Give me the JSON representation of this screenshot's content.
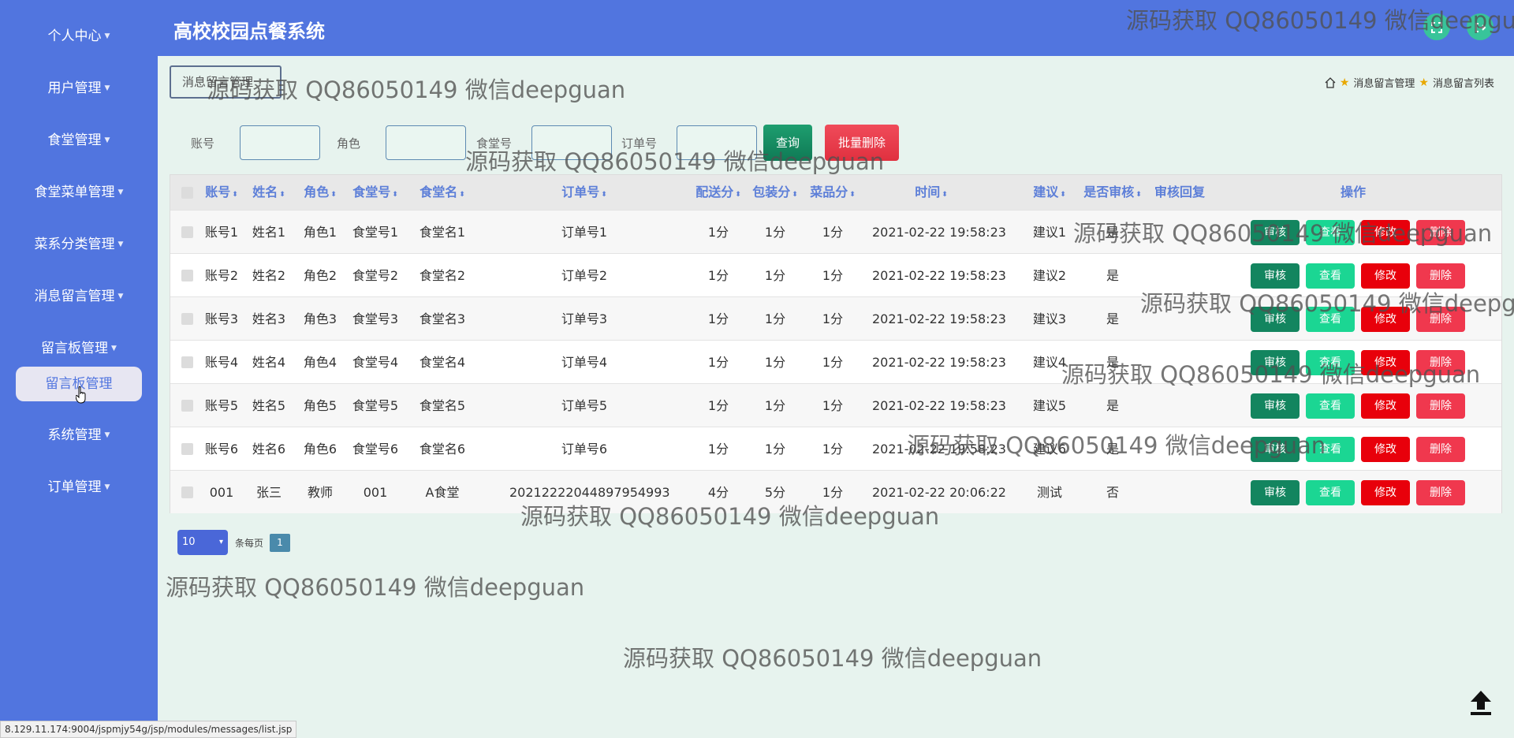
{
  "app": {
    "title": "高校校园点餐系统"
  },
  "sidebar": {
    "items": [
      {
        "label": "个人中心"
      },
      {
        "label": "用户管理"
      },
      {
        "label": "食堂管理"
      },
      {
        "label": "食堂菜单管理"
      },
      {
        "label": "菜系分类管理"
      },
      {
        "label": "消息留言管理"
      },
      {
        "label": "留言板管理"
      },
      {
        "label": "系统管理"
      },
      {
        "label": "订单管理"
      }
    ],
    "active_sub": "留言板管理"
  },
  "page": {
    "title": "消息留言管理",
    "breadcrumb": [
      "消息留言管理",
      "消息留言列表"
    ]
  },
  "search": {
    "fields": [
      {
        "label": "账号",
        "value": ""
      },
      {
        "label": "角色",
        "value": ""
      },
      {
        "label": "食堂号",
        "value": ""
      },
      {
        "label": "订单号",
        "value": ""
      }
    ],
    "search_button": "查询",
    "batch_delete_button": "批量删除"
  },
  "table": {
    "headers": [
      "账号",
      "姓名",
      "角色",
      "食堂号",
      "食堂名",
      "订单号",
      "配送分",
      "包装分",
      "菜品分",
      "时间",
      "建议",
      "是否审核",
      "审核回复",
      "操作"
    ],
    "actions": {
      "audit": "审核",
      "view": "查看",
      "edit": "修改",
      "delete": "删除"
    },
    "rows": [
      [
        "账号1",
        "姓名1",
        "角色1",
        "食堂号1",
        "食堂名1",
        "订单号1",
        "1分",
        "1分",
        "1分",
        "2021-02-22 19:58:23",
        "建议1",
        "是",
        ""
      ],
      [
        "账号2",
        "姓名2",
        "角色2",
        "食堂号2",
        "食堂名2",
        "订单号2",
        "1分",
        "1分",
        "1分",
        "2021-02-22 19:58:23",
        "建议2",
        "是",
        ""
      ],
      [
        "账号3",
        "姓名3",
        "角色3",
        "食堂号3",
        "食堂名3",
        "订单号3",
        "1分",
        "1分",
        "1分",
        "2021-02-22 19:58:23",
        "建议3",
        "是",
        ""
      ],
      [
        "账号4",
        "姓名4",
        "角色4",
        "食堂号4",
        "食堂名4",
        "订单号4",
        "1分",
        "1分",
        "1分",
        "2021-02-22 19:58:23",
        "建议4",
        "是",
        ""
      ],
      [
        "账号5",
        "姓名5",
        "角色5",
        "食堂号5",
        "食堂名5",
        "订单号5",
        "1分",
        "1分",
        "1分",
        "2021-02-22 19:58:23",
        "建议5",
        "是",
        ""
      ],
      [
        "账号6",
        "姓名6",
        "角色6",
        "食堂号6",
        "食堂名6",
        "订单号6",
        "1分",
        "1分",
        "1分",
        "2021-02-22 19:58:23",
        "建议6",
        "是",
        ""
      ],
      [
        "001",
        "张三",
        "教师",
        "001",
        "A食堂",
        "20212222044897954993",
        "4分",
        "5分",
        "1分",
        "2021-02-22 20:06:22",
        "测试",
        "否",
        ""
      ]
    ]
  },
  "pagination": {
    "page_size": "10",
    "per_page_label": "条每页",
    "current_page": "1"
  },
  "watermark": {
    "text": "源码获取 QQ86050149 微信deepguan"
  },
  "status_url": "8.129.11.174:9004/jspmjy54g/jsp/modules/messages/list.jsp",
  "colors": {
    "primary": "#5175df",
    "background": "#e7f3ee",
    "audit": "#13855f",
    "view": "#1bd693",
    "edit": "#e8000b",
    "delete": "#f0384e"
  }
}
